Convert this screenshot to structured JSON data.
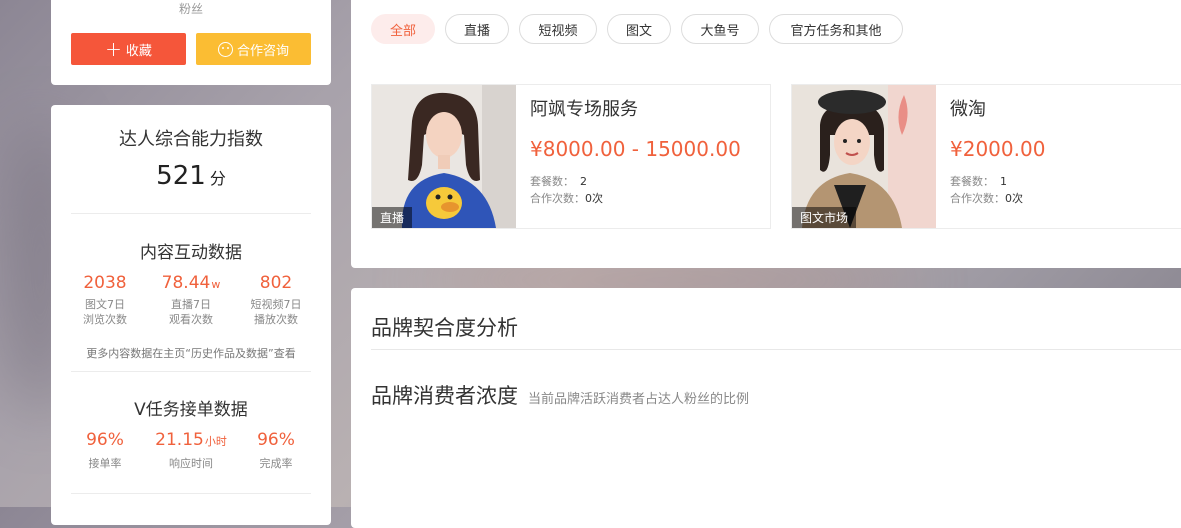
{
  "profile": {
    "fans_label": "粉丝",
    "favorite_label": "收藏",
    "consult_label": "合作咨询"
  },
  "ability": {
    "title": "达人综合能力指数",
    "score": "521",
    "score_unit": "分"
  },
  "content_stats": {
    "title": "内容互动数据",
    "items": [
      {
        "value": "2038",
        "unit": "",
        "line1": "图文7日",
        "line2": "浏览次数"
      },
      {
        "value": "78.44",
        "unit": "w",
        "line1": "直播7日",
        "line2": "观看次数"
      },
      {
        "value": "802",
        "unit": "",
        "line1": "短视频7日",
        "line2": "播放次数"
      }
    ],
    "note": "更多内容数据在主页“历史作品及数据”查看"
  },
  "task_stats": {
    "title": "V任务接单数据",
    "items": [
      {
        "value": "96%",
        "unit": "",
        "label": "接单率"
      },
      {
        "value": "21.15",
        "unit": "小时",
        "label": "响应时间"
      },
      {
        "value": "96%",
        "unit": "",
        "label": "完成率"
      }
    ]
  },
  "tabs": [
    "全部",
    "直播",
    "短视频",
    "图文",
    "大鱼号",
    "官方任务和其他"
  ],
  "active_tab": "全部",
  "services": [
    {
      "tag": "直播",
      "name": "阿飒专场服务",
      "price": "¥8000.00 - 15000.00",
      "packages_label": "套餐数：",
      "packages": "2",
      "coop_label": "合作次数：",
      "coop": "0次"
    },
    {
      "tag": "图文市场",
      "name": "微淘",
      "price": "¥2000.00",
      "packages_label": "套餐数：",
      "packages": "1",
      "coop_label": "合作次数：",
      "coop": "0次"
    }
  ],
  "brand": {
    "title": "品牌契合度分析",
    "consumer_title": "品牌消费者浓度",
    "consumer_sub": "当前品牌活跃消费者占达人粉丝的比例"
  },
  "colors": {
    "accent": "#f0613c",
    "favorite_button": "#f5563a",
    "consult_button": "#fbbd33",
    "active_tab_bg": "#fdeceb"
  }
}
